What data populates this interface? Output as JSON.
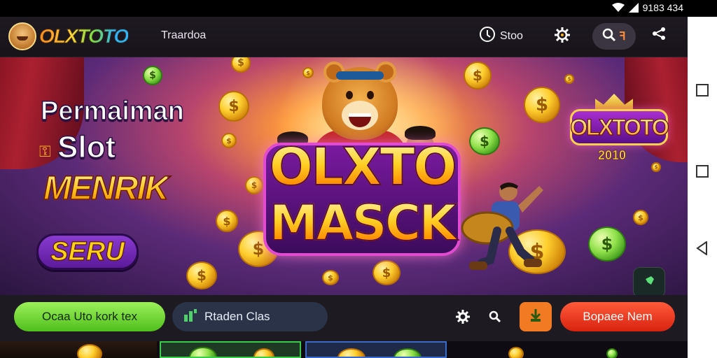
{
  "status_bar": {
    "time": "9183 434"
  },
  "header": {
    "logo_text": "OLXTOTO",
    "nav_link": "Traardoa",
    "slot_label": "Stoo",
    "search_suffix": "ꟻ"
  },
  "banner": {
    "headline_1": "Permaiman",
    "headline_2": "Slot",
    "headline_3": "MENRIK",
    "headline_4": "SERU",
    "game_title_1": "OLXTO",
    "game_title_2": "MASCK",
    "badge_title": "OLXTOTO",
    "badge_year": "2010",
    "coin_symbol": "$"
  },
  "bottom_bar": {
    "login_label": "Ocaa Uto kork tex",
    "chat_label": "Rtaden Clas",
    "daftar_label": "Bopaee Nem"
  },
  "colors": {
    "login": "#4fbf1c",
    "daftar": "#d8230f",
    "orange_button": "#f27a22",
    "chat": "#2a3348"
  }
}
